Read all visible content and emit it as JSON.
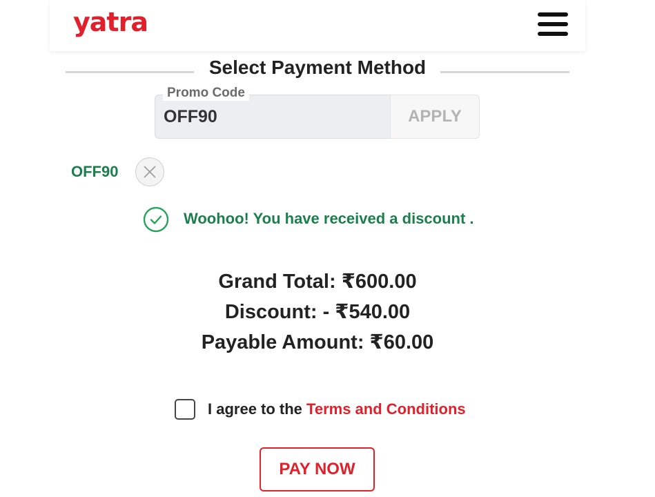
{
  "header": {
    "logo_text": "yatra",
    "menu_icon": "hamburger-menu-icon",
    "brand_color": "#e0212c"
  },
  "payment": {
    "section_title": "Select Payment Method",
    "promo": {
      "label": "Promo Code",
      "value": "OFF90",
      "apply_label": "APPLY",
      "applied_code": "OFF90",
      "remove_icon": "close-icon",
      "success_icon": "check-circle-icon",
      "success_message": "Woohoo! You have received a discount .",
      "success_color": "#1a7f4b"
    },
    "summary": {
      "grand_total": "Grand Total: ₹600.00",
      "discount": "Discount: - ₹540.00",
      "payable": "Payable Amount: ₹60.00"
    },
    "terms": {
      "checked": false,
      "prefix": "I agree to the",
      "link_text": "Terms and Conditions"
    },
    "pay_label": "PAY NOW"
  }
}
